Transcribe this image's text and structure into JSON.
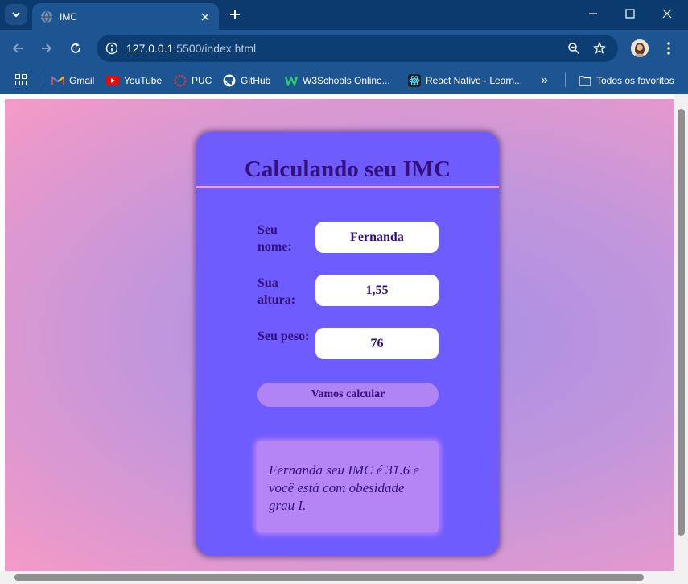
{
  "browser": {
    "tab": {
      "title": "IMC"
    },
    "address": {
      "host": "127.0.0.1",
      "path": ":5500/index.html"
    },
    "bookmarks": [
      {
        "label": "Gmail",
        "icon": "gmail-icon"
      },
      {
        "label": "YouTube",
        "icon": "youtube-icon"
      },
      {
        "label": "PUC",
        "icon": "puc-icon"
      },
      {
        "label": "GitHub",
        "icon": "github-icon"
      },
      {
        "label": "W3Schools Online...",
        "icon": "w3schools-icon"
      },
      {
        "label": "React Native · Learn...",
        "icon": "react-icon"
      }
    ],
    "bookmarks_overflow": "»",
    "all_bookmarks": "Todos os favoritos"
  },
  "app": {
    "title": "Calculando seu IMC",
    "fields": [
      {
        "label": "Seu nome:",
        "value": "Fernanda"
      },
      {
        "label": "Sua altura:",
        "value": "1,55"
      },
      {
        "label": "Seu peso:",
        "value": "76"
      }
    ],
    "button": "Vamos calcular",
    "result": "Fernanda seu IMC é 31.6 e você está com obesidade grau I."
  },
  "colors": {
    "browser_frame": "#0b3a6e",
    "toolbar": "#1c5592",
    "card": "#6e5cff",
    "card_text": "#33107a",
    "divider": "#f79ccf",
    "button": "#b184f5",
    "result_box": "#b585f5",
    "page_gradient_center": "#a78ee6",
    "page_gradient_edge": "#f59ac6"
  }
}
